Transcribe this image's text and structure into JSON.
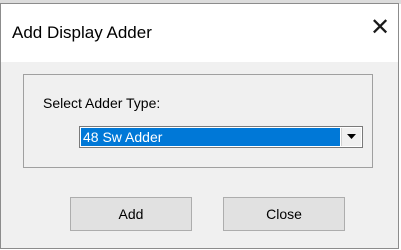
{
  "dialog": {
    "title": "Add Display Adder",
    "close_icon": "close-icon",
    "group": {
      "label": "Select Adder Type:",
      "combo": {
        "selected": "48 Sw Adder",
        "dropdown_icon": "chevron-down-icon"
      }
    },
    "buttons": {
      "add_label": "Add",
      "close_label": "Close"
    }
  },
  "colors": {
    "selection": "#0078d7",
    "dialog_bg": "#f0f0f0",
    "button_bg": "#e1e1e1"
  }
}
